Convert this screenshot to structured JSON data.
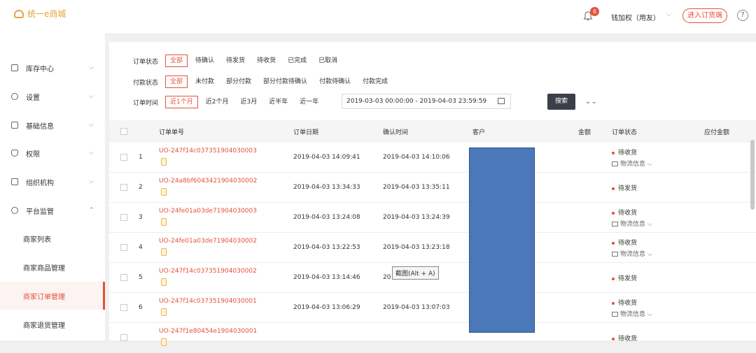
{
  "app": {
    "logo_text": "统一e商城"
  },
  "header": {
    "badge_count": "6",
    "user": "钱加权（用友）",
    "caret": "⌵",
    "enter_button": "进入订货端",
    "help": "?"
  },
  "sidebar": {
    "items": [
      {
        "label": "库存中心",
        "caret": "⌵"
      },
      {
        "label": "设置",
        "caret": "⌵"
      },
      {
        "label": "基础信息",
        "caret": "⌵"
      },
      {
        "label": "权限",
        "caret": "⌵"
      },
      {
        "label": "组织机构",
        "caret": "⌵"
      },
      {
        "label": "平台监管",
        "caret": "⌃"
      }
    ],
    "sub_items": [
      {
        "label": "商家列表"
      },
      {
        "label": "商家商品管理"
      },
      {
        "label": "商家订单管理"
      },
      {
        "label": "商家退货管理"
      }
    ]
  },
  "filters": {
    "order_status": {
      "label": "订单状态",
      "options": [
        "全部",
        "待确认",
        "待发货",
        "待收货",
        "已完成",
        "已取消"
      ]
    },
    "pay_status": {
      "label": "付款状态",
      "options": [
        "全部",
        "未付款",
        "部分付款",
        "部分付款待确认",
        "付款待确认",
        "付款完成"
      ]
    },
    "order_time": {
      "label": "订单时间",
      "options": [
        "近1个月",
        "近2个月",
        "近3月",
        "近半年",
        "近一年"
      ]
    },
    "date_range": "2019-03-03 00:00:00 - 2019-04-03 23:59:59",
    "search_button": "搜索",
    "expand": "⌄⌄"
  },
  "table": {
    "headers": [
      "订单单号",
      "订单日期",
      "确认时间",
      "客户",
      "金额",
      "订单状态",
      "应付金额"
    ],
    "logistics_label": "物流信息",
    "rows": [
      {
        "index": "1",
        "order_no": "UO-247f14c037351904030003",
        "order_date": "2019-04-03 14:09:41",
        "confirm_time": "2019-04-03 14:10:06",
        "status": "待收货",
        "logistics": true
      },
      {
        "index": "2",
        "order_no": "UO-24a8bf6043421904030002",
        "order_date": "2019-04-03 13:34:33",
        "confirm_time": "2019-04-03 13:35:11",
        "status": "待发货",
        "logistics": false
      },
      {
        "index": "3",
        "order_no": "UO-24fe01a03de71904030003",
        "order_date": "2019-04-03 13:24:08",
        "confirm_time": "2019-04-03 13:24:39",
        "status": "待收货",
        "logistics": true
      },
      {
        "index": "4",
        "order_no": "UO-24fe01a03de71904030002",
        "order_date": "2019-04-03 13:22:53",
        "confirm_time": "2019-04-03 13:23:18",
        "status": "待收货",
        "logistics": true
      },
      {
        "index": "5",
        "order_no": "UO-247f14c037351904030002",
        "order_date": "2019-04-03 13:14:46",
        "confirm_time": "20",
        "status": "待发货",
        "logistics": false
      },
      {
        "index": "6",
        "order_no": "UO-247f14c037351904030001",
        "order_date": "2019-04-03 13:06:29",
        "confirm_time": "2019-04-03 13:07:03",
        "status": "待收货",
        "logistics": true
      },
      {
        "index": "",
        "order_no": "UO-247f1e80454e1904030001",
        "order_date": "",
        "confirm_time": "",
        "status": "待收货",
        "logistics": false
      }
    ]
  },
  "tooltip": "截图(Alt + A)"
}
